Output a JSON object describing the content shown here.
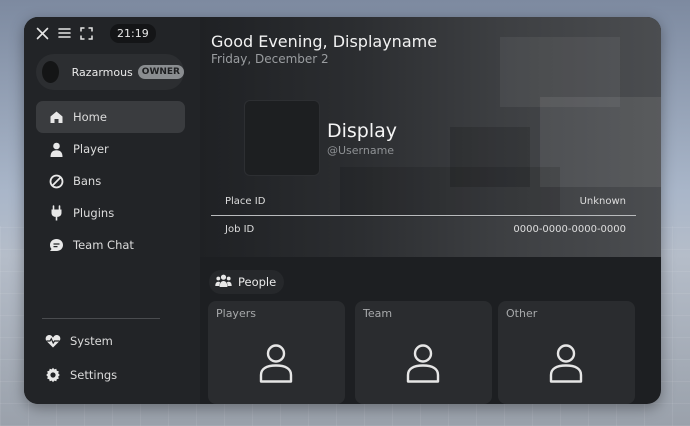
{
  "topbar": {
    "time": "21:19",
    "icons": [
      "close-icon",
      "menu-icon",
      "fullscreen-icon"
    ]
  },
  "profile": {
    "name": "Razarmous",
    "badge": "OWNER"
  },
  "nav": [
    {
      "label": "Home",
      "icon": "home-icon",
      "active": true
    },
    {
      "label": "Player",
      "icon": "person-icon"
    },
    {
      "label": "Bans",
      "icon": "ban-icon"
    },
    {
      "label": "Plugins",
      "icon": "plug-icon"
    },
    {
      "label": "Team Chat",
      "icon": "chat-icon"
    }
  ],
  "bottom_nav": [
    {
      "label": "System",
      "icon": "heart-pulse-icon"
    },
    {
      "label": "Settings",
      "icon": "gear-icon"
    }
  ],
  "header": {
    "greeting": "Good Evening, Displayname",
    "date": "Friday, December 2"
  },
  "game": {
    "display": "Display",
    "username": "@Username"
  },
  "info": {
    "place_label": "Place ID",
    "place_value": "Unknown",
    "job_label": "Job ID",
    "job_value": "0000-0000-0000-0000"
  },
  "people": {
    "title": "People",
    "cards": [
      {
        "label": "Players"
      },
      {
        "label": "Team"
      },
      {
        "label": "Other"
      }
    ]
  },
  "colors": {
    "window_bg": "#1d1f22",
    "sidebar_bg": "#222427",
    "active_item": "#3a3c3f",
    "badge_bg": "#8a8d90"
  }
}
